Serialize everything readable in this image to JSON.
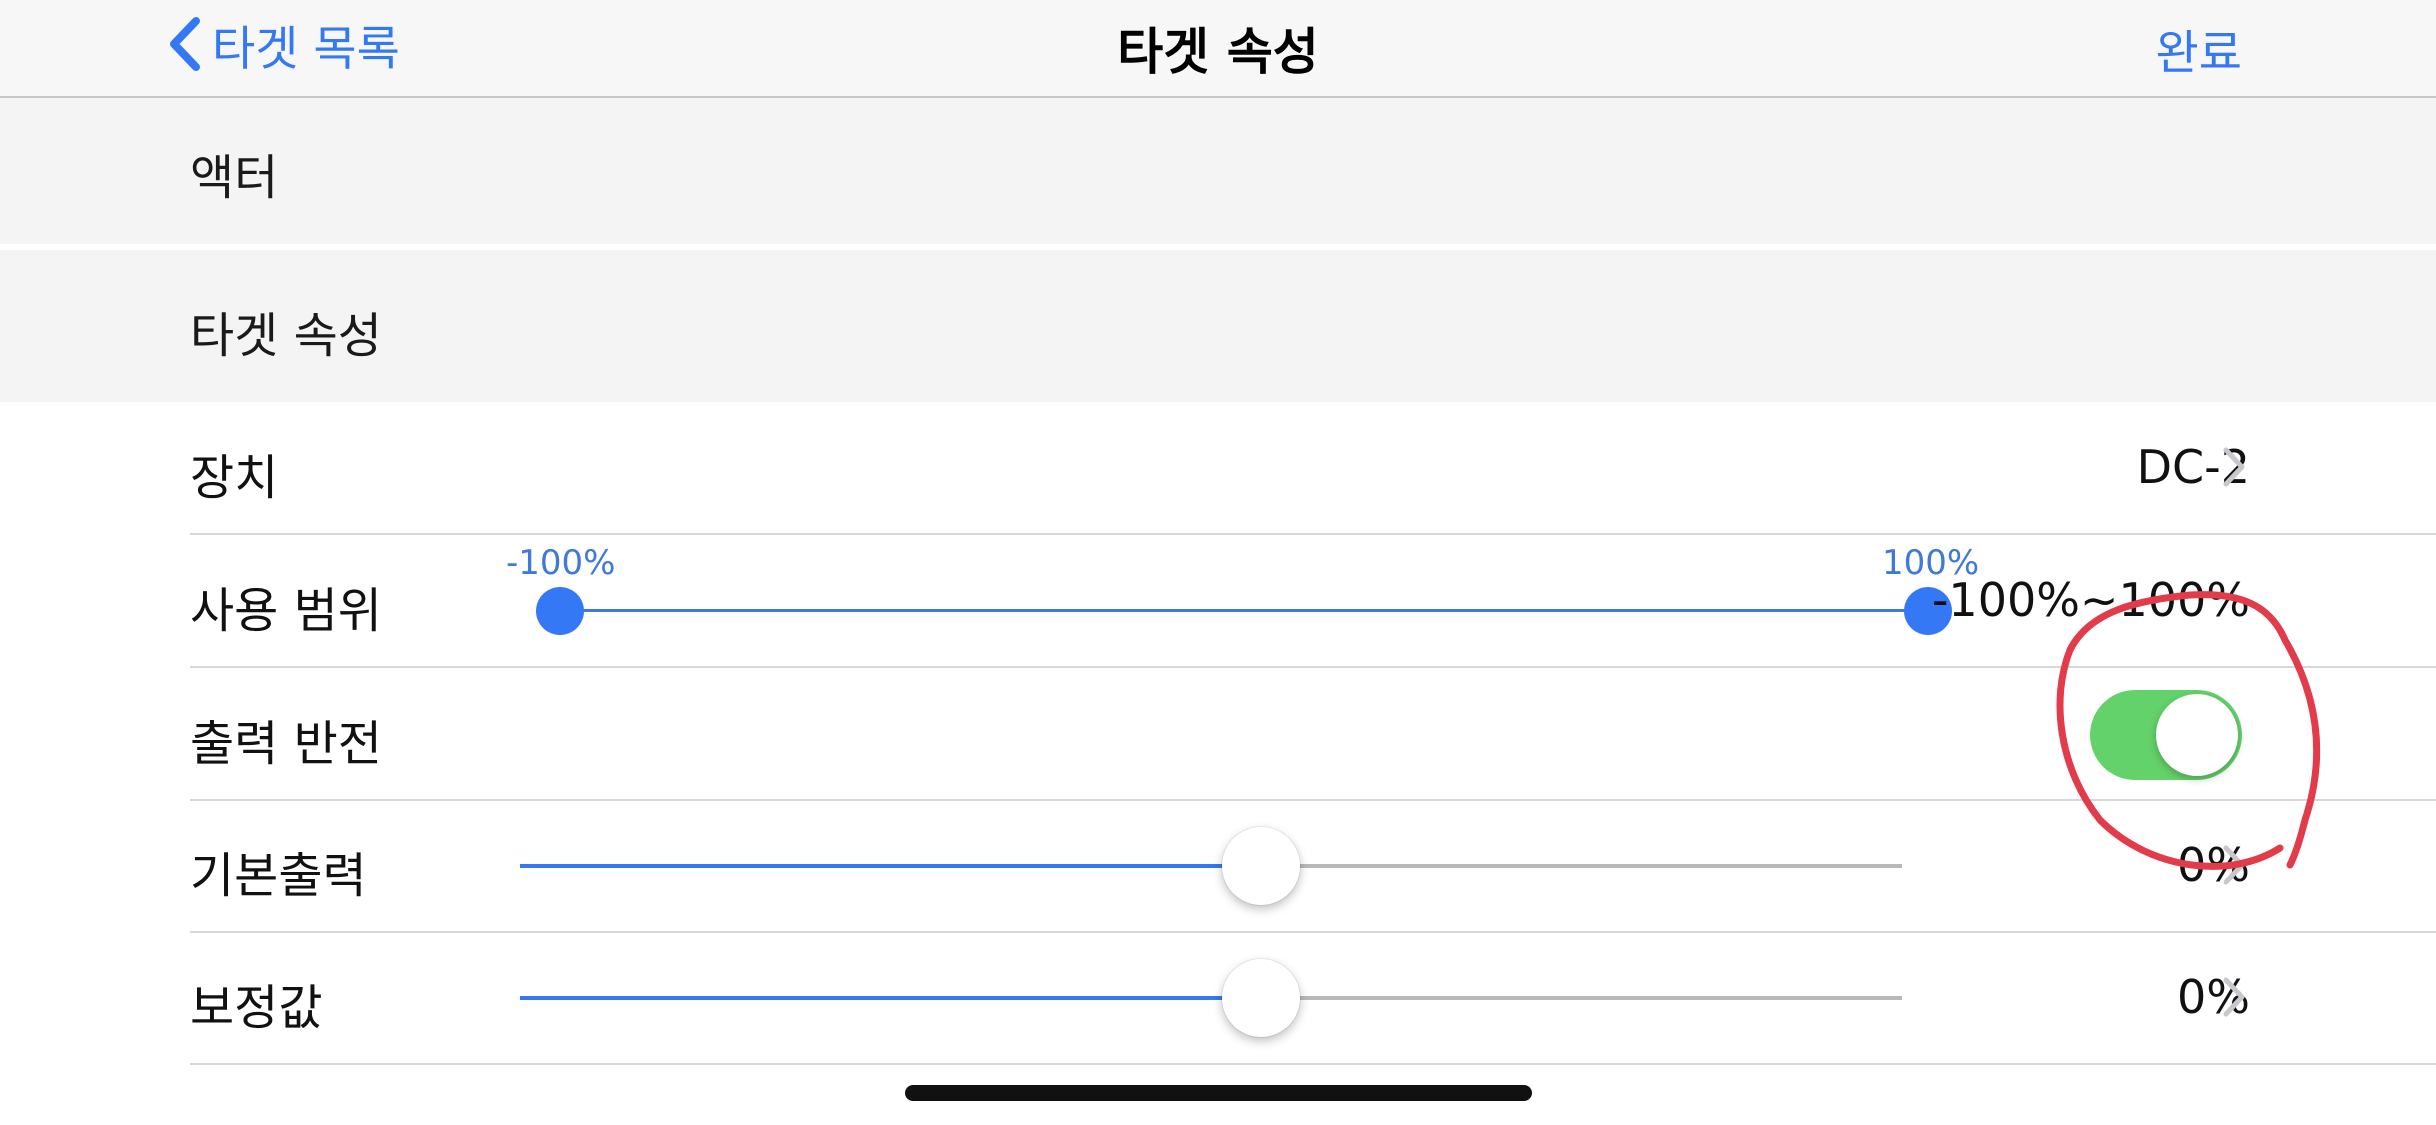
{
  "nav": {
    "back_label": "타겟 목록",
    "title": "타겟 속성",
    "done_label": "완료"
  },
  "sections": {
    "actor": "액터",
    "target_props": "타겟 속성"
  },
  "rows": {
    "device": {
      "label": "장치",
      "value": "DC-2"
    },
    "range": {
      "label": "사용 범위",
      "min_label": "-100%",
      "max_label": "100%",
      "value": "-100%~100%"
    },
    "invert": {
      "label": "출력 반전",
      "on": true
    },
    "default_output": {
      "label": "기본출력",
      "value": "0%",
      "slider_fraction": 0.5
    },
    "offset": {
      "label": "보정값",
      "value": "0%",
      "slider_fraction": 0.5
    }
  },
  "colors": {
    "accent": "#3478f6",
    "toggle_on": "#63d26a",
    "annotation": "#e23b4a"
  }
}
